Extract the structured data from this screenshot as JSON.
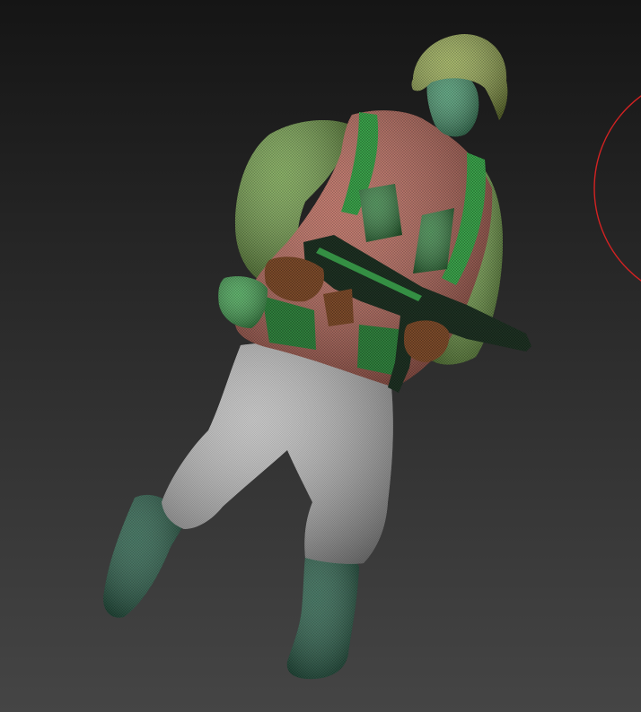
{
  "viewport": {
    "background_top": "#151515",
    "background_bottom": "#454545"
  },
  "model": {
    "subject": "soldier-sculpt",
    "colors": {
      "helmet": "#93a849",
      "skin": "#3f9468",
      "jacket_sleeves": "#6f9f43",
      "vest": "#b65d4e",
      "straps": "#3aa14a",
      "pants": "#b9b9b9",
      "boots": "#1f5b43",
      "gloves": "#7b4a2a",
      "rifle": "#1d3022",
      "wire_dark": "#0c160f"
    }
  },
  "brush_cursor": {
    "color": "#d42222"
  }
}
